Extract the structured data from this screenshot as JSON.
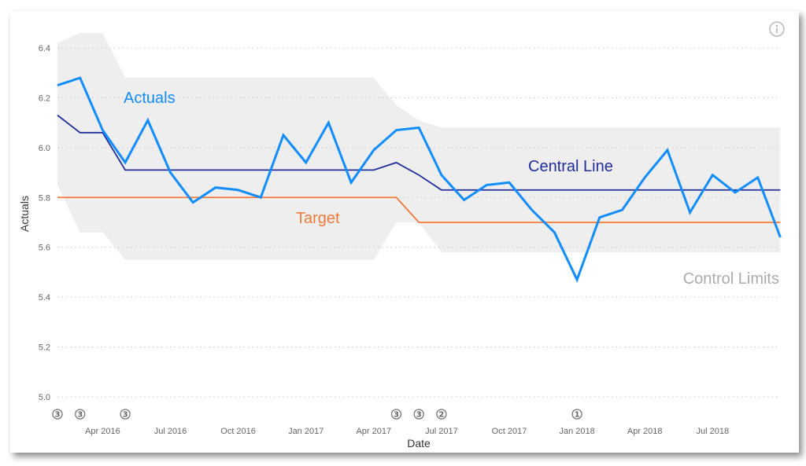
{
  "chart_data": {
    "type": "line",
    "title": "",
    "xlabel": "Date",
    "ylabel": "Actuals",
    "ylim": [
      5.0,
      6.4
    ],
    "y_ticks": [
      5.0,
      5.2,
      5.4,
      5.6,
      5.8,
      6.0,
      6.2,
      6.4
    ],
    "y_tick_labels": [
      "5.0",
      "5.2",
      "5.4",
      "5.6",
      "5.8",
      "6.0",
      "6.2",
      "6.4"
    ],
    "grid": "horizontal dotted",
    "x_tick_labels": [
      {
        "month_index": 2,
        "label": "Apr 2016"
      },
      {
        "month_index": 5,
        "label": "Jul 2016"
      },
      {
        "month_index": 8,
        "label": "Oct 2016"
      },
      {
        "month_index": 11,
        "label": "Jan 2017"
      },
      {
        "month_index": 14,
        "label": "Apr 2017"
      },
      {
        "month_index": 17,
        "label": "Jul 2017"
      },
      {
        "month_index": 20,
        "label": "Oct 2017"
      },
      {
        "month_index": 23,
        "label": "Jan 2018"
      },
      {
        "month_index": 26,
        "label": "Apr 2018"
      },
      {
        "month_index": 29,
        "label": "Jul 2018"
      }
    ],
    "x": [
      "Feb 2016",
      "Mar 2016",
      "Apr 2016",
      "May 2016",
      "Jun 2016",
      "Jul 2016",
      "Aug 2016",
      "Sep 2016",
      "Oct 2016",
      "Nov 2016",
      "Dec 2016",
      "Jan 2017",
      "Feb 2017",
      "Mar 2017",
      "Apr 2017",
      "May 2017",
      "Jun 2017",
      "Jul 2017",
      "Aug 2017",
      "Sep 2017",
      "Oct 2017",
      "Nov 2017",
      "Dec 2017",
      "Jan 2018",
      "Feb 2018",
      "Mar 2018",
      "Apr 2018",
      "May 2018",
      "Jun 2018",
      "Jul 2018",
      "Aug 2018",
      "Sep 2018",
      "Oct 2018"
    ],
    "series": [
      {
        "name": "Actuals",
        "color": "#118DFF",
        "values": [
          6.25,
          6.28,
          6.07,
          5.94,
          6.11,
          5.9,
          5.78,
          5.84,
          5.83,
          5.8,
          6.05,
          5.94,
          6.1,
          5.86,
          5.99,
          6.07,
          6.08,
          5.89,
          5.79,
          5.85,
          5.86,
          5.75,
          5.66,
          5.47,
          5.72,
          5.75,
          5.88,
          5.99,
          5.74,
          5.89,
          5.82,
          5.88,
          5.64
        ]
      },
      {
        "name": "Central Line",
        "color": "#1F2E99",
        "values": [
          6.13,
          6.06,
          6.06,
          5.91,
          5.91,
          5.91,
          5.91,
          5.91,
          5.91,
          5.91,
          5.91,
          5.91,
          5.91,
          5.91,
          5.91,
          5.94,
          5.89,
          5.83,
          5.83,
          5.83,
          5.83,
          5.83,
          5.83,
          5.83,
          5.83,
          5.83,
          5.83,
          5.83,
          5.83,
          5.83,
          5.83,
          5.83,
          5.83
        ]
      },
      {
        "name": "Target",
        "color": "#F07A3A",
        "values": [
          5.8,
          5.8,
          5.8,
          5.8,
          5.8,
          5.8,
          5.8,
          5.8,
          5.8,
          5.8,
          5.8,
          5.8,
          5.8,
          5.8,
          5.8,
          5.8,
          5.7,
          5.7,
          5.7,
          5.7,
          5.7,
          5.7,
          5.7,
          5.7,
          5.7,
          5.7,
          5.7,
          5.7,
          5.7,
          5.7,
          5.7,
          5.7,
          5.7
        ]
      },
      {
        "name": "Control Limits Upper",
        "color": "#EEEEEE",
        "values": [
          6.42,
          6.46,
          6.46,
          6.28,
          6.28,
          6.28,
          6.28,
          6.28,
          6.28,
          6.28,
          6.28,
          6.28,
          6.28,
          6.28,
          6.28,
          6.17,
          6.11,
          6.08,
          6.08,
          6.08,
          6.08,
          6.08,
          6.08,
          6.08,
          6.08,
          6.08,
          6.08,
          6.08,
          6.08,
          6.08,
          6.08,
          6.08,
          6.08
        ]
      },
      {
        "name": "Control Limits Lower",
        "color": "#EEEEEE",
        "values": [
          5.85,
          5.66,
          5.66,
          5.55,
          5.55,
          5.55,
          5.55,
          5.55,
          5.55,
          5.55,
          5.55,
          5.55,
          5.55,
          5.55,
          5.55,
          5.7,
          5.7,
          5.58,
          5.58,
          5.58,
          5.58,
          5.58,
          5.58,
          5.58,
          5.58,
          5.58,
          5.58,
          5.58,
          5.58,
          5.58,
          5.58,
          5.58,
          5.58
        ]
      }
    ],
    "annotations": [
      {
        "text": "Actuals",
        "color": "#118DFF"
      },
      {
        "text": "Central Line",
        "color": "#1F2E99"
      },
      {
        "text": "Target",
        "color": "#F07A3A"
      },
      {
        "text": "Control Limits",
        "color": "#AAAAAA"
      }
    ],
    "rule_markers": [
      {
        "month_index": 0,
        "label": "3"
      },
      {
        "month_index": 1,
        "label": "3"
      },
      {
        "month_index": 3,
        "label": "3"
      },
      {
        "month_index": 15,
        "label": "3"
      },
      {
        "month_index": 16,
        "label": "3"
      },
      {
        "month_index": 17,
        "label": "2"
      },
      {
        "month_index": 23,
        "label": "1"
      }
    ],
    "legend": "none (inline annotations)"
  },
  "ui": {
    "info_icon": "info-icon"
  }
}
